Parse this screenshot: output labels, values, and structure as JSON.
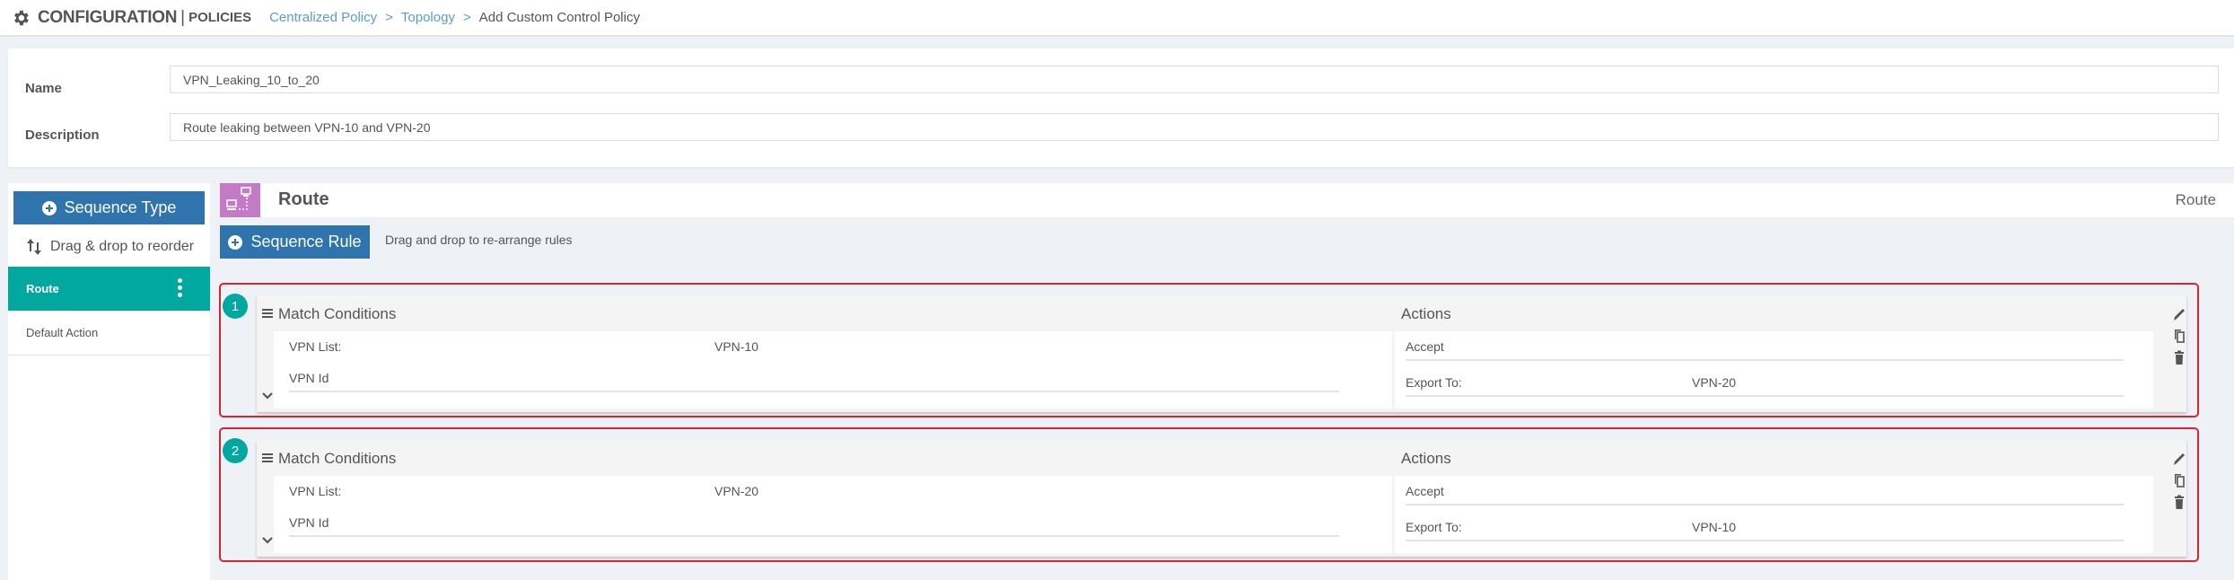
{
  "header": {
    "title": "CONFIGURATION",
    "separator": "|",
    "subtitle": "POLICIES",
    "breadcrumb": [
      {
        "label": "Centralized Policy"
      },
      {
        "label": "Topology"
      }
    ],
    "breadcrumb_arrow": ">",
    "current": "Add Custom Control Policy",
    "icon": "gear-icon"
  },
  "form": {
    "name_label": "Name",
    "name_value": "VPN_Leaking_10_to_20",
    "description_label": "Description",
    "description_value": "Route leaking between VPN-10 and VPN-20"
  },
  "sidebar": {
    "sequence_type_label": "Sequence Type",
    "drag_hint": "Drag & drop to reorder",
    "items": [
      {
        "label": "Route",
        "active": true
      },
      {
        "label": "Default Action",
        "active": false
      }
    ]
  },
  "main": {
    "section_title": "Route",
    "section_type": "Route",
    "sequence_rule_label": "Sequence Rule",
    "drag_hint": "Drag and drop to re-arrange rules",
    "rules": [
      {
        "number": "1",
        "match_title": "Match Conditions",
        "actions_title": "Actions",
        "vpn_list_label": "VPN List:",
        "vpn_list_value": "VPN-10",
        "vpn_id_label": "VPN Id",
        "action": "Accept",
        "export_label": "Export To:",
        "export_value": "VPN-20"
      },
      {
        "number": "2",
        "match_title": "Match Conditions",
        "actions_title": "Actions",
        "vpn_list_label": "VPN List:",
        "vpn_list_value": "VPN-20",
        "vpn_id_label": "VPN Id",
        "action": "Accept",
        "export_label": "Export To:",
        "export_value": "VPN-10"
      }
    ]
  },
  "colors": {
    "primary_button": "#2f74ac",
    "active_teal": "#00a8a0",
    "route_icon_bg": "#c27bc4",
    "highlight_border": "#d9252f",
    "link": "#5b9bd5"
  }
}
